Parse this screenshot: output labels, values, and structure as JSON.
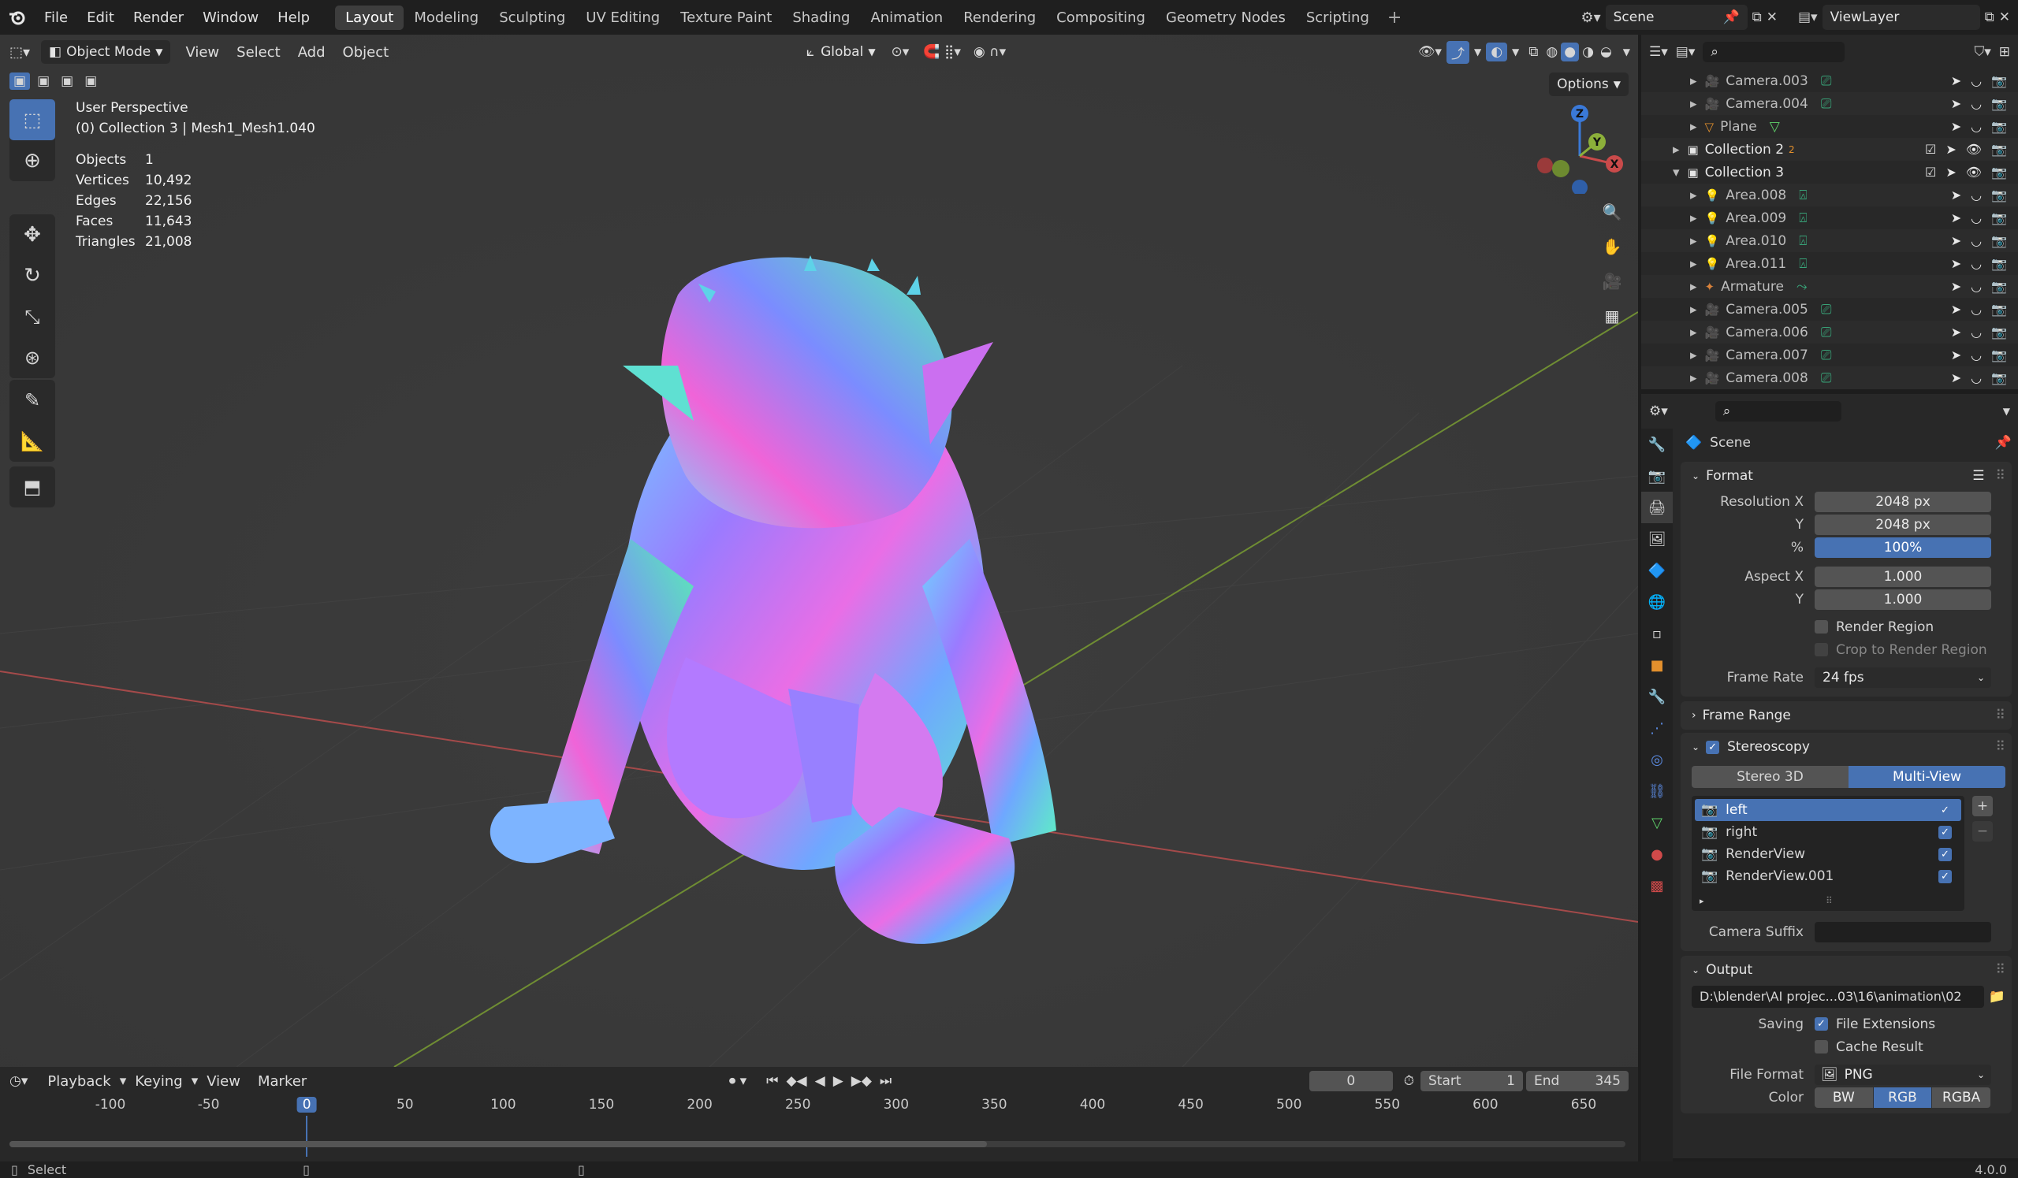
{
  "app": {
    "menus": [
      "File",
      "Edit",
      "Render",
      "Window",
      "Help"
    ],
    "workspaces": [
      "Layout",
      "Modeling",
      "Sculpting",
      "UV Editing",
      "Texture Paint",
      "Shading",
      "Animation",
      "Rendering",
      "Compositing",
      "Geometry Nodes",
      "Scripting"
    ],
    "active_workspace": "Layout",
    "add_workspace": "+",
    "scene": "Scene",
    "view_layer": "ViewLayer"
  },
  "viewport": {
    "mode": "Object Mode",
    "menus": [
      "View",
      "Select",
      "Add",
      "Object"
    ],
    "transform_orientation": "Global",
    "options_label": "Options",
    "overlay_title": "User Perspective",
    "overlay_subtitle": "(0) Collection 3 | Mesh1_Mesh1.040",
    "stats": [
      {
        "label": "Objects",
        "value": "1"
      },
      {
        "label": "Vertices",
        "value": "10,492"
      },
      {
        "label": "Edges",
        "value": "22,156"
      },
      {
        "label": "Faces",
        "value": "11,643"
      },
      {
        "label": "Triangles",
        "value": "21,008"
      }
    ],
    "gizmo": {
      "z": "Z",
      "y": "Y",
      "x": "X"
    }
  },
  "outliner": {
    "rows": [
      {
        "name": "Camera.003",
        "kind": "camera",
        "expanded": false,
        "indent": 2
      },
      {
        "name": "Camera.004",
        "kind": "camera",
        "expanded": false,
        "indent": 2
      },
      {
        "name": "Plane",
        "kind": "mesh",
        "expanded": false,
        "indent": 2
      },
      {
        "name": "Collection 2",
        "kind": "collection",
        "expanded": false,
        "indent": 1,
        "badge": "2"
      },
      {
        "name": "Collection 3",
        "kind": "collection",
        "expanded": true,
        "indent": 1
      },
      {
        "name": "Area.008",
        "kind": "light",
        "expanded": false,
        "indent": 2
      },
      {
        "name": "Area.009",
        "kind": "light",
        "expanded": false,
        "indent": 2
      },
      {
        "name": "Area.010",
        "kind": "light",
        "expanded": false,
        "indent": 2
      },
      {
        "name": "Area.011",
        "kind": "light",
        "expanded": false,
        "indent": 2
      },
      {
        "name": "Armature",
        "kind": "armature",
        "expanded": false,
        "indent": 2
      },
      {
        "name": "Camera.005",
        "kind": "camera",
        "expanded": false,
        "indent": 2
      },
      {
        "name": "Camera.006",
        "kind": "camera",
        "expanded": false,
        "indent": 2
      },
      {
        "name": "Camera.007",
        "kind": "camera",
        "expanded": false,
        "indent": 2
      },
      {
        "name": "Camera.008",
        "kind": "camera",
        "expanded": false,
        "indent": 2
      }
    ]
  },
  "properties": {
    "context": "Scene",
    "format": {
      "title": "Format",
      "resolution_x_label": "Resolution X",
      "resolution_x": "2048 px",
      "resolution_y_label": "Y",
      "resolution_y": "2048 px",
      "percent_label": "%",
      "percent": "100%",
      "aspect_x_label": "Aspect X",
      "aspect_x": "1.000",
      "aspect_y_label": "Y",
      "aspect_y": "1.000",
      "render_region": "Render Region",
      "crop": "Crop to Render Region",
      "frame_rate_label": "Frame Rate",
      "frame_rate": "24 fps"
    },
    "frame_range": "Frame Range",
    "stereoscopy": {
      "title": "Stereoscopy",
      "tab_a": "Stereo 3D",
      "tab_b": "Multi-View",
      "views": [
        "left",
        "right",
        "RenderView",
        "RenderView.001"
      ],
      "camera_suffix_label": "Camera Suffix",
      "camera_suffix": ""
    },
    "output": {
      "title": "Output",
      "path": "D:\\blender\\AI projec...03\\16\\animation\\02",
      "saving_label": "Saving",
      "file_extensions": "File Extensions",
      "cache_result": "Cache Result",
      "file_format_label": "File Format",
      "file_format": "PNG",
      "color_label": "Color",
      "color_options": [
        "BW",
        "RGB",
        "RGBA"
      ],
      "color_selected": "RGB"
    }
  },
  "timeline": {
    "menus": [
      "Playback",
      "Keying",
      "View",
      "Marker"
    ],
    "current_frame": "0",
    "start_label": "Start",
    "start": "1",
    "end_label": "End",
    "end": "345",
    "ticks": [
      "-100",
      "-50",
      "0",
      "50",
      "100",
      "150",
      "200",
      "250",
      "300",
      "350",
      "400",
      "450",
      "500",
      "550",
      "600",
      "650"
    ]
  },
  "statusbar": {
    "select_label": "Select",
    "version": "4.0.0"
  },
  "colors": {
    "accent": "#4772b3",
    "viewport_bg": "#3a3a3a",
    "x_axis": "#c94a4a",
    "y_axis": "#8cb03a",
    "z_axis": "#3a79d8"
  }
}
